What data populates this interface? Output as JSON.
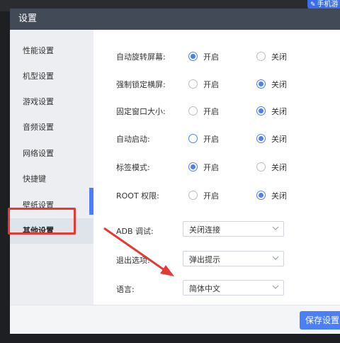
{
  "top_badge": {
    "text": "手机游"
  },
  "dialog": {
    "title": "设置"
  },
  "sidebar": {
    "items": [
      {
        "label": "性能设置"
      },
      {
        "label": "机型设置"
      },
      {
        "label": "游戏设置"
      },
      {
        "label": "音频设置"
      },
      {
        "label": "网络设置"
      },
      {
        "label": "快捷键"
      },
      {
        "label": "壁纸设置"
      },
      {
        "label": "其他设置"
      }
    ],
    "active_index": 7
  },
  "settings": {
    "auto_rotate": {
      "label": "自动旋转屏幕:",
      "on": "开启",
      "off": "关闭",
      "selected": "开启"
    },
    "force_landscape": {
      "label": "强制锁定横屏:",
      "on": "开启",
      "off": "关闭",
      "selected": "关闭"
    },
    "fixed_window": {
      "label": "固定窗口大小:",
      "on": "开启",
      "off": "关闭",
      "selected": "关闭"
    },
    "auto_start": {
      "label": "自动启动:",
      "on": "开启",
      "off": "关闭",
      "selected": "关闭"
    },
    "tab_mode": {
      "label": "标签模式:",
      "on": "开启",
      "off": "关闭",
      "selected": "开启"
    },
    "root": {
      "label": "ROOT 权限:",
      "on": "开启",
      "off": "关闭",
      "selected": "关闭"
    },
    "adb": {
      "label": "ADB 调试:",
      "value": "关闭连接"
    },
    "exit_option": {
      "label": "退出选项:",
      "value": "弹出提示"
    },
    "language": {
      "label": "语言:",
      "value": "简体中文"
    }
  },
  "footer": {
    "save_label": "保存设置"
  },
  "colors": {
    "accent": "#4c7ff7",
    "title_bar": "#424a57",
    "annotation": "#e53935"
  }
}
